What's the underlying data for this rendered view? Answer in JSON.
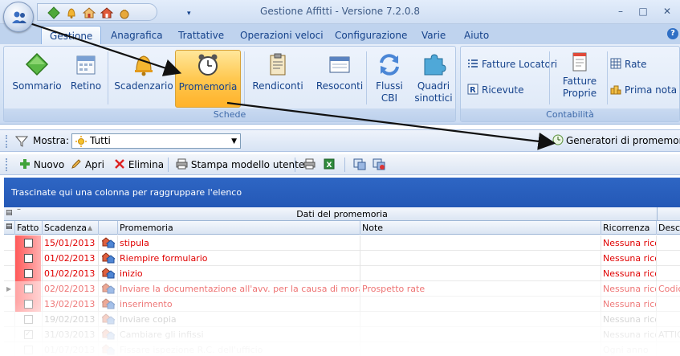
{
  "window": {
    "title": "Gestione Affitti - Versione 7.2.0.8",
    "controls": [
      "–",
      "□",
      "✕"
    ]
  },
  "qat": {
    "icons": [
      "green-diamond-icon",
      "bell-icon",
      "house-icon",
      "money-bag-icon"
    ],
    "dropdown_glyph": "▾"
  },
  "tabs": [
    "Gestione",
    "Anagrafica",
    "Trattative",
    "Operazioni veloci",
    "Configurazione",
    "Varie",
    "Aiuto"
  ],
  "active_tab": "Gestione",
  "help_glyph": "?",
  "ribbon": {
    "schede": {
      "label": "Schede",
      "buttons": [
        "Sommario",
        "Retino",
        "Scadenzario",
        "Promemoria",
        "Rendiconti",
        "Resoconti",
        "Flussi CBI",
        "Quadri sinottici"
      ]
    },
    "contabilita": {
      "label": "Contabilità",
      "fatture_locatori": "Fatture Locatori",
      "ricevute": "Ricevute",
      "fatture_proprie": "Fatture Proprie",
      "rate": "Rate",
      "prima_nota": "Prima nota"
    }
  },
  "filter": {
    "label": "Mostra:",
    "value": "Tutti",
    "generators_button": "Generatori di promemoria"
  },
  "toolbar": {
    "nuovo": "Nuovo",
    "apri": "Apri",
    "elimina": "Elimina",
    "stampa": "Stampa modello utente"
  },
  "grid": {
    "group_hint": "Trascinate qui una colonna per raggruppare l'elenco",
    "band_title": "Dati del promemoria",
    "columns": [
      "Fatto",
      "Scadenza",
      "",
      "Promemoria",
      "Note",
      "Ricorrenza",
      "Descr"
    ],
    "rows": [
      {
        "done": false,
        "date": "15/01/2013",
        "promemoria": "stipula",
        "note": "",
        "ricorrenza": "Nessuna ricor",
        "descr": ""
      },
      {
        "done": false,
        "date": "01/02/2013",
        "promemoria": "Riempire formulario",
        "note": "",
        "ricorrenza": "Nessuna ricor",
        "descr": ""
      },
      {
        "done": false,
        "date": "01/02/2013",
        "promemoria": "inizio",
        "note": "",
        "ricorrenza": "Nessuna ricor",
        "descr": ""
      },
      {
        "done": false,
        "date": "02/02/2013",
        "promemoria": "Inviare la documentazione all'avv. per la causa di mora",
        "note": "Prospetto rate",
        "ricorrenza": "Nessuna ricor",
        "descr": "Codic"
      },
      {
        "done": false,
        "date": "13/02/2013",
        "promemoria": "inserimento",
        "note": "",
        "ricorrenza": "Nessuna ricor",
        "descr": ""
      },
      {
        "done": false,
        "date": "19/02/2013",
        "promemoria": "Inviare copia",
        "note": "",
        "ricorrenza": "Nessuna ricor",
        "descr": ""
      },
      {
        "done": true,
        "date": "31/03/2013",
        "promemoria": "Cambiare gli infissi",
        "note": "",
        "ricorrenza": "Nessuna ricor",
        "descr": "ATTIC"
      },
      {
        "done": false,
        "date": "01/07/2013",
        "promemoria": "Fissare ispezione R.C. dell'ufficio",
        "note": "",
        "ricorrenza": "Ogni anno",
        "descr": ""
      }
    ]
  },
  "colors": {
    "overdue_red": "#e00000",
    "header_blue": "#2a5fbe",
    "ribbon_text": "#15428b"
  }
}
